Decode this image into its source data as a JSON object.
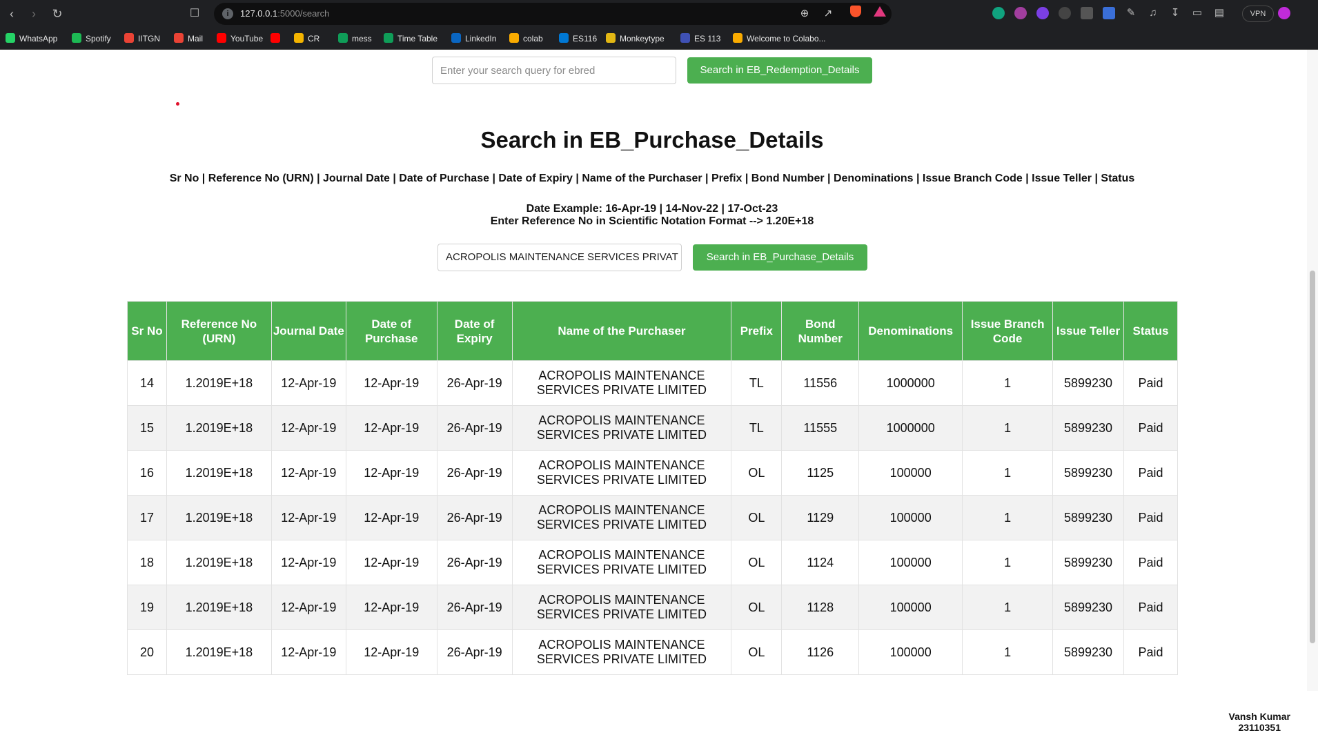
{
  "browser": {
    "url_host": "127.0.0.1",
    "url_path": ":5000/search",
    "vpn_label": "VPN"
  },
  "bookmarks": [
    {
      "label": "WhatsApp",
      "icon": "whatsapp-icon",
      "color": "#25d366"
    },
    {
      "label": "Spotify",
      "icon": "spotify-icon",
      "color": "#1db954"
    },
    {
      "label": "IITGN",
      "icon": "gmail-icon",
      "color": "#ea4335"
    },
    {
      "label": "Mail",
      "icon": "gmail-icon",
      "color": "#ea4335"
    },
    {
      "label": "YouTube",
      "icon": "youtube-icon",
      "color": "#ff0000"
    },
    {
      "label": "",
      "icon": "youtube-icon",
      "color": "#ff0000"
    },
    {
      "label": "CR",
      "icon": "slides-icon",
      "color": "#f4b400"
    },
    {
      "label": "mess",
      "icon": "sheets-icon",
      "color": "#0f9d58"
    },
    {
      "label": "Time Table",
      "icon": "sheets-icon",
      "color": "#0f9d58"
    },
    {
      "label": "LinkedIn",
      "icon": "linkedin-icon",
      "color": "#0a66c2"
    },
    {
      "label": "colab",
      "icon": "colab-icon",
      "color": "#f9ab00"
    },
    {
      "label": "ES116",
      "icon": "onedrive-icon",
      "color": "#0078d4"
    },
    {
      "label": "Monkeytype",
      "icon": "monkeytype-icon",
      "color": "#e2b714"
    },
    {
      "label": "ES 113",
      "icon": "classroom-icon",
      "color": "#3f51b5"
    },
    {
      "label": "Welcome to Colabo...",
      "icon": "colab-icon",
      "color": "#f9ab00"
    }
  ],
  "top_search": {
    "placeholder": "Enter your search query for ebred",
    "button_label": "Search in EB_Redemption_Details"
  },
  "purchase_search": {
    "title": "Search in EB_Purchase_Details",
    "columns_line": "Sr No | Reference No (URN) | Journal Date | Date of Purchase | Date of Expiry | Name of the Purchaser | Prefix | Bond Number | Denominations | Issue Branch Code | Issue Teller | Status",
    "date_example": "Date Example: 16-Apr-19 | 14-Nov-22 | 17-Oct-23",
    "ref_hint": "Enter Reference No in Scientific Notation Format --> 1.20E+18",
    "input_value": "ACROPOLIS MAINTENANCE SERVICES PRIVAT",
    "button_label": "Search in EB_Purchase_Details"
  },
  "table": {
    "headers": [
      "Sr No",
      "Reference No (URN)",
      "Journal Date",
      "Date of Purchase",
      "Date of Expiry",
      "Name of the Purchaser",
      "Prefix",
      "Bond Number",
      "Denominations",
      "Issue Branch Code",
      "Issue Teller",
      "Status"
    ],
    "rows": [
      [
        "14",
        "1.2019E+18",
        "12-Apr-19",
        "12-Apr-19",
        "26-Apr-19",
        "ACROPOLIS MAINTENANCE SERVICES PRIVATE LIMITED",
        "TL",
        "11556",
        "1000000",
        "1",
        "5899230",
        "Paid"
      ],
      [
        "15",
        "1.2019E+18",
        "12-Apr-19",
        "12-Apr-19",
        "26-Apr-19",
        "ACROPOLIS MAINTENANCE SERVICES PRIVATE LIMITED",
        "TL",
        "11555",
        "1000000",
        "1",
        "5899230",
        "Paid"
      ],
      [
        "16",
        "1.2019E+18",
        "12-Apr-19",
        "12-Apr-19",
        "26-Apr-19",
        "ACROPOLIS MAINTENANCE SERVICES PRIVATE LIMITED",
        "OL",
        "1125",
        "100000",
        "1",
        "5899230",
        "Paid"
      ],
      [
        "17",
        "1.2019E+18",
        "12-Apr-19",
        "12-Apr-19",
        "26-Apr-19",
        "ACROPOLIS MAINTENANCE SERVICES PRIVATE LIMITED",
        "OL",
        "1129",
        "100000",
        "1",
        "5899230",
        "Paid"
      ],
      [
        "18",
        "1.2019E+18",
        "12-Apr-19",
        "12-Apr-19",
        "26-Apr-19",
        "ACROPOLIS MAINTENANCE SERVICES PRIVATE LIMITED",
        "OL",
        "1124",
        "100000",
        "1",
        "5899230",
        "Paid"
      ],
      [
        "19",
        "1.2019E+18",
        "12-Apr-19",
        "12-Apr-19",
        "26-Apr-19",
        "ACROPOLIS MAINTENANCE SERVICES PRIVATE LIMITED",
        "OL",
        "1128",
        "100000",
        "1",
        "5899230",
        "Paid"
      ],
      [
        "20",
        "1.2019E+18",
        "12-Apr-19",
        "12-Apr-19",
        "26-Apr-19",
        "ACROPOLIS MAINTENANCE SERVICES PRIVATE LIMITED",
        "OL",
        "1126",
        "100000",
        "1",
        "5899230",
        "Paid"
      ]
    ]
  },
  "footer": {
    "name": "Vansh Kumar",
    "id": "23110351"
  },
  "colors": {
    "accent_green": "#4caf50",
    "chrome_dark": "#1f2023"
  }
}
